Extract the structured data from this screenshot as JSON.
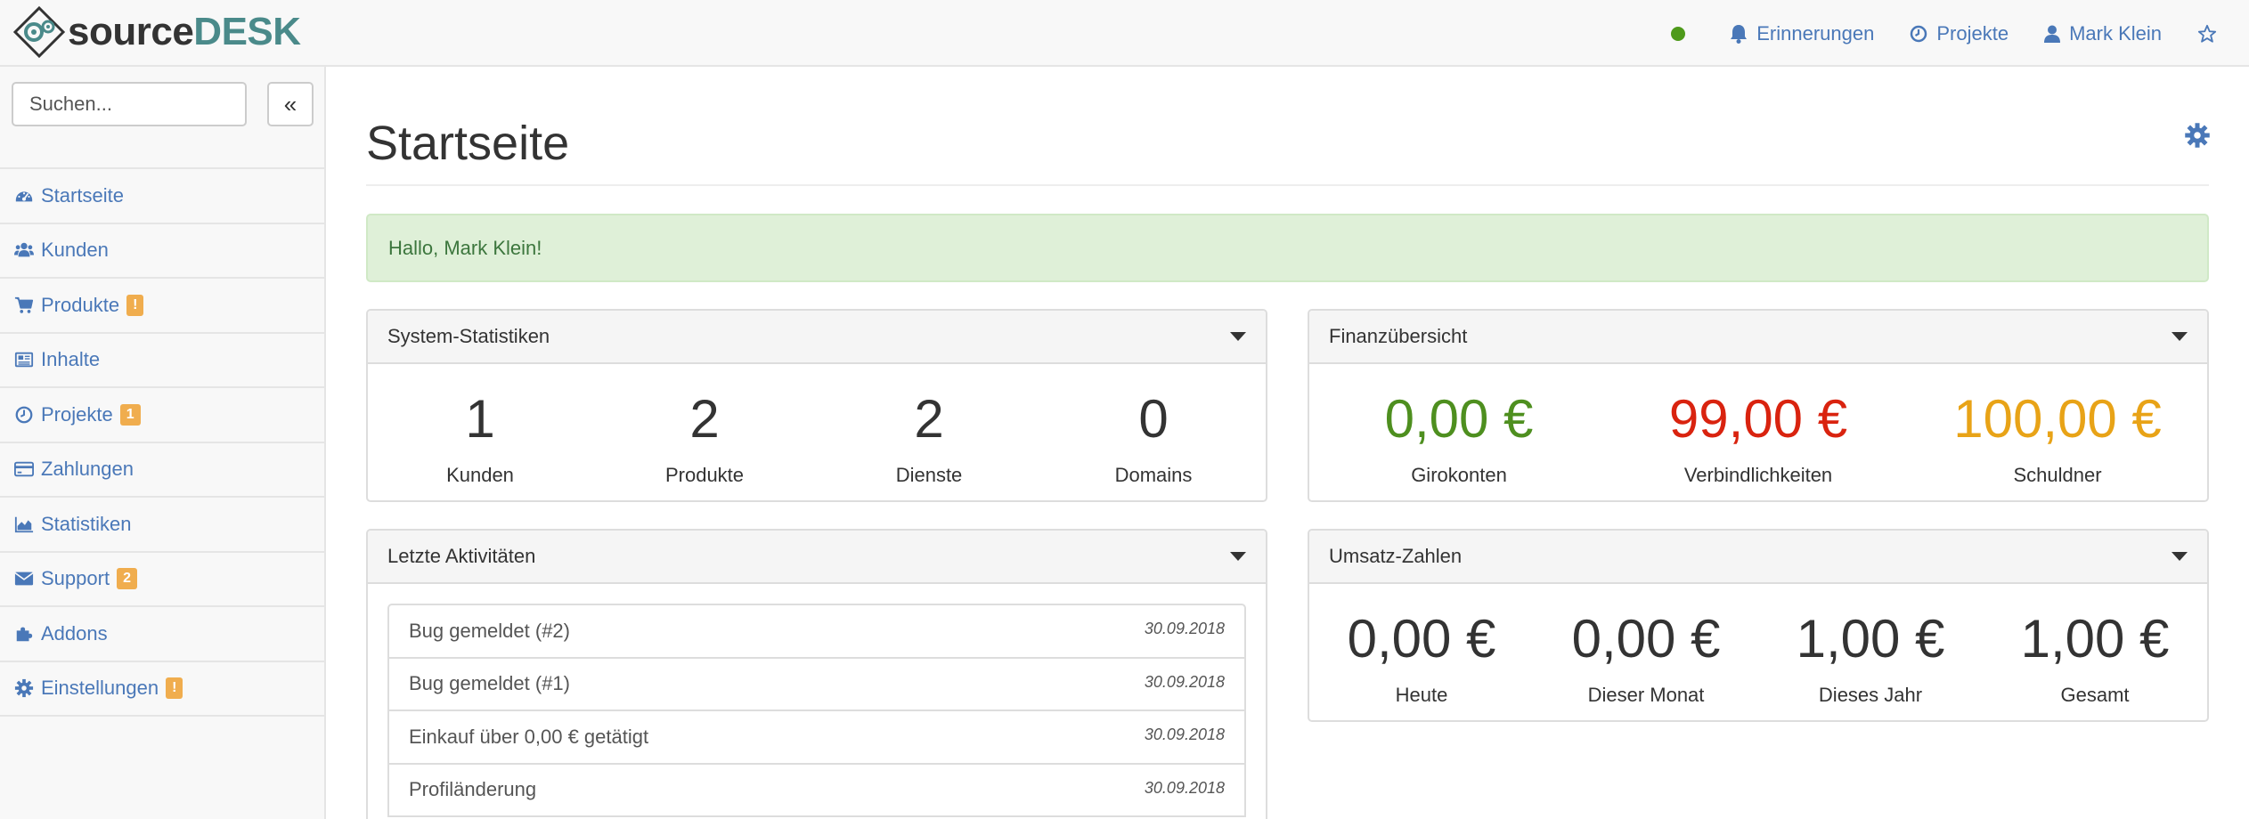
{
  "brand": {
    "part1": "source",
    "part2": "DESK"
  },
  "nav": {
    "reminders": "Erinnerungen",
    "projects": "Projekte",
    "user": "Mark Klein"
  },
  "sidebar": {
    "search_placeholder": "Suchen...",
    "collapse_label": "«",
    "items": [
      {
        "label": "Startseite",
        "icon": "dashboard-icon"
      },
      {
        "label": "Kunden",
        "icon": "users-icon"
      },
      {
        "label": "Produkte",
        "icon": "cart-icon",
        "badge": "!"
      },
      {
        "label": "Inhalte",
        "icon": "newspaper-icon"
      },
      {
        "label": "Projekte",
        "icon": "clock-icon",
        "badge": "1"
      },
      {
        "label": "Zahlungen",
        "icon": "credit-card-icon"
      },
      {
        "label": "Statistiken",
        "icon": "area-chart-icon"
      },
      {
        "label": "Support",
        "icon": "envelope-icon",
        "badge": "2"
      },
      {
        "label": "Addons",
        "icon": "puzzle-icon"
      },
      {
        "label": "Einstellungen",
        "icon": "gear-icon",
        "badge": "!"
      }
    ]
  },
  "main": {
    "title": "Startseite",
    "greeting": "Hallo, Mark Klein!",
    "system_stats": {
      "heading": "System-Statistiken",
      "items": [
        {
          "value": "1",
          "label": "Kunden"
        },
        {
          "value": "2",
          "label": "Produkte"
        },
        {
          "value": "2",
          "label": "Dienste"
        },
        {
          "value": "0",
          "label": "Domains"
        }
      ]
    },
    "finance": {
      "heading": "Finanzübersicht",
      "items": [
        {
          "value": "0,00 €",
          "label": "Girokonten",
          "color": "#4e8f1f"
        },
        {
          "value": "99,00 €",
          "label": "Verbindlichkeiten",
          "color": "#d9230f"
        },
        {
          "value": "100,00 €",
          "label": "Schuldner",
          "color": "#e8a317"
        }
      ]
    },
    "activities": {
      "heading": "Letzte Aktivitäten",
      "rows": [
        {
          "text": "Bug gemeldet (#2)",
          "date": "30.09.2018"
        },
        {
          "text": "Bug gemeldet (#1)",
          "date": "30.09.2018"
        },
        {
          "text": "Einkauf über 0,00 € getätigt",
          "date": "30.09.2018"
        },
        {
          "text": "Profiländerung",
          "date": "30.09.2018"
        }
      ]
    },
    "revenue": {
      "heading": "Umsatz-Zahlen",
      "items": [
        {
          "value": "0,00 €",
          "label": "Heute"
        },
        {
          "value": "0,00 €",
          "label": "Dieser Monat"
        },
        {
          "value": "1,00 €",
          "label": "Dieses Jahr"
        },
        {
          "value": "1,00 €",
          "label": "Gesamt"
        }
      ]
    }
  },
  "colors": {
    "link": "#4a78b8",
    "status_online": "#4e9a1b",
    "badge": "#f0ad4e",
    "success_bg": "#dff0d8"
  }
}
